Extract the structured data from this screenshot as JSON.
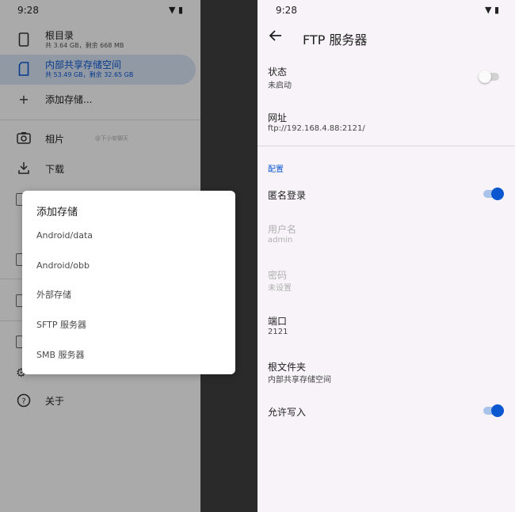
{
  "left": {
    "status": {
      "time": "9:28",
      "icons": "▼ ▮"
    },
    "drawer": {
      "root": {
        "label": "根目录",
        "sub": "共 3.64 GB，剩余 668 MB",
        "icon": "phone-icon"
      },
      "internal": {
        "label": "内部共享存储空间",
        "sub": "共 53.49 GB，剩余 32.65 GB",
        "icon": "sd-card-icon"
      },
      "add_storage": {
        "label": "添加存储...",
        "icon": "plus-icon"
      },
      "photos": {
        "label": "相片",
        "icon": "camera-icon"
      },
      "downloads": {
        "label": "下载",
        "icon": "download-icon"
      },
      "about": {
        "label": "关于",
        "icon": "help-icon"
      },
      "watermark": "@下小安聊天"
    },
    "dialog": {
      "title": "添加存储",
      "options": [
        "Android/data",
        "Android/obb",
        "外部存储",
        "SFTP 服务器",
        "SMB 服务器"
      ]
    }
  },
  "right": {
    "status": {
      "time": "9:28",
      "icons": "▼ ▮"
    },
    "appbar": {
      "title": "FTP 服务器"
    },
    "status_pref": {
      "title": "状态",
      "summary": "未启动",
      "on": false
    },
    "address_pref": {
      "title": "网址",
      "summary": "ftp://192.168.4.88:2121/"
    },
    "section": "配置",
    "anonymous_pref": {
      "title": "匿名登录",
      "on": true
    },
    "username_pref": {
      "title": "用户名",
      "summary": "admin"
    },
    "password_pref": {
      "title": "密码",
      "summary": "未设置"
    },
    "port_pref": {
      "title": "端口",
      "summary": "2121"
    },
    "root_pref": {
      "title": "根文件夹",
      "summary": "内部共享存储空间"
    },
    "write_pref": {
      "title": "允许写入",
      "on": true
    }
  },
  "colors": {
    "accent": "#0b57d0",
    "selected_bg": "#d6e2f3",
    "right_bg": "#f7f3f8"
  }
}
